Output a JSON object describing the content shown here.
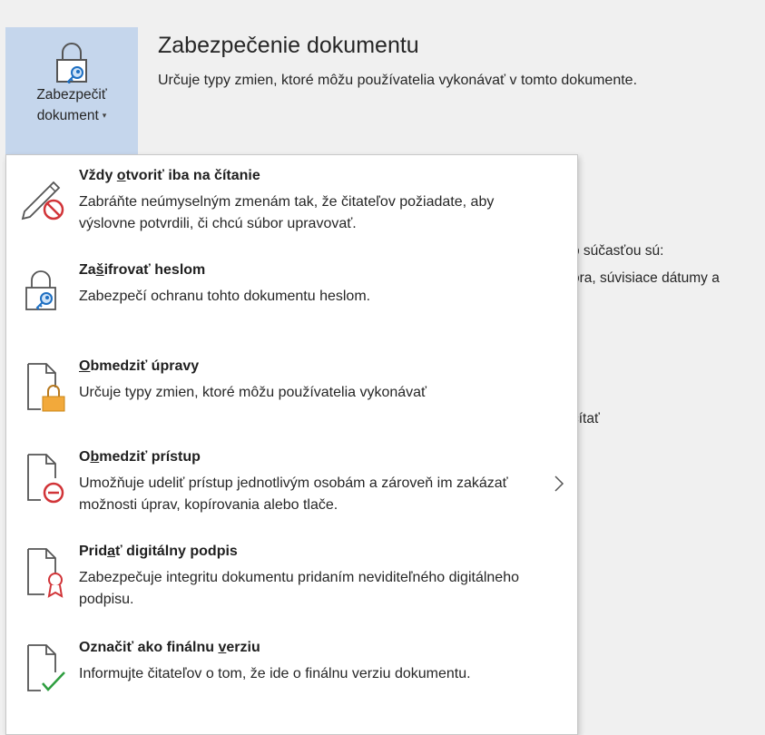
{
  "protect_button": {
    "label_line1": "Zabezpečiť",
    "label_line2": "dokument",
    "caret": "▾",
    "icon": "lock-key-icon"
  },
  "section": {
    "title": "Zabezpečenie dokumentu",
    "description": "Určuje typy zmien, ktoré môžu používatelia vykonávať v tomto dokumente."
  },
  "background_text": {
    "line1": "o súčasťou sú:",
    "line2": "ora, súvisiace dátumy a",
    "line3": "čítať"
  },
  "menu": {
    "items": [
      {
        "icon": "pencil-prohibited-icon",
        "title_pre": "Vždy ",
        "title_key": "o",
        "title_post": "tvoriť iba na čítanie",
        "description": "Zabráňte neúmyselným zmenám tak, že čitateľov požiadate, aby výslovne potvrdili, či chcú súbor upravovať."
      },
      {
        "icon": "lock-key-icon",
        "title_pre": "Za",
        "title_key": "š",
        "title_post": "ifrovať heslom",
        "description": "Zabezpečí ochranu tohto dokumentu heslom."
      },
      {
        "icon": "document-lock-icon",
        "title_pre": "",
        "title_key": "O",
        "title_post": "bmedziť úpravy",
        "description": "Určuje typy zmien, ktoré môžu používatelia vykonávať"
      },
      {
        "icon": "document-restricted-icon",
        "title_pre": "O",
        "title_key": "b",
        "title_post": "medziť prístup",
        "description": "Umožňuje udeliť prístup jednotlivým osobám a zároveň im zakázať možnosti úprav, kopírovania alebo tlače.",
        "has_submenu": true
      },
      {
        "icon": "document-ribbon-icon",
        "title_pre": "Prid",
        "title_key": "a",
        "title_post": "ť digitálny podpis",
        "description": "Zabezpečuje integritu dokumentu pridaním neviditeľného digitálneho podpisu."
      },
      {
        "icon": "document-check-icon",
        "title_pre": "Označiť ako finálnu ",
        "title_key": "v",
        "title_post": "erziu",
        "description": "Informujte čitateľov o tom, že ide o finálnu verziu dokumentu."
      }
    ]
  },
  "colors": {
    "button_bg": "#c5d6ec",
    "prohibit_red": "#d13438",
    "lock_orange": "#f2a93b",
    "check_green": "#2e9e3f",
    "key_blue": "#1e6fc2"
  }
}
